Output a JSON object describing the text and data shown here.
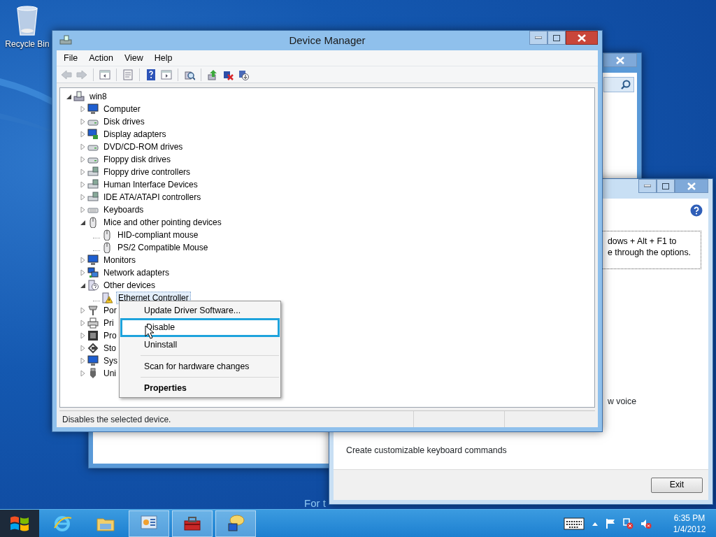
{
  "desktop": {
    "icons": [
      {
        "label": "Recycle Bin"
      }
    ],
    "background_text": "For t"
  },
  "ease_of_access": {
    "hint_lines": [
      "dows + Alt + F1 to",
      "e through the options."
    ],
    "fragment": "w voice",
    "section": {
      "description": "Create customizable keyboard commands"
    },
    "exit_button": "Exit"
  },
  "device_manager": {
    "title": "Device Manager",
    "menu": [
      "File",
      "Action",
      "View",
      "Help"
    ],
    "toolbar": [
      [
        {
          "kind": "back",
          "disabled": true
        },
        {
          "kind": "forward",
          "disabled": true
        }
      ],
      [
        {
          "kind": "tree-pane",
          "disabled": false
        }
      ],
      [
        {
          "kind": "properties",
          "disabled": false
        }
      ],
      [
        {
          "kind": "help",
          "disabled": false
        },
        {
          "kind": "action-pane",
          "disabled": false
        }
      ],
      [
        {
          "kind": "scan",
          "disabled": false
        }
      ],
      [
        {
          "kind": "update",
          "disabled": false
        },
        {
          "kind": "disable",
          "disabled": false
        },
        {
          "kind": "uninstall",
          "disabled": false
        }
      ]
    ],
    "tree": {
      "label": "win8",
      "kind": "host",
      "expanded": true,
      "selected": false,
      "children": [
        {
          "label": "Computer",
          "kind": "computer",
          "expanded": false,
          "selected": false
        },
        {
          "label": "Disk drives",
          "kind": "disk",
          "expanded": false,
          "selected": false
        },
        {
          "label": "Display adapters",
          "kind": "display",
          "expanded": false,
          "selected": false
        },
        {
          "label": "DVD/CD-ROM drives",
          "kind": "disk",
          "expanded": false,
          "selected": false
        },
        {
          "label": "Floppy disk drives",
          "kind": "disk",
          "expanded": false,
          "selected": false
        },
        {
          "label": "Floppy drive controllers",
          "kind": "controller",
          "expanded": false,
          "selected": false
        },
        {
          "label": "Human Interface Devices",
          "kind": "controller",
          "expanded": false,
          "selected": false
        },
        {
          "label": "IDE ATA/ATAPI controllers",
          "kind": "controller",
          "expanded": false,
          "selected": false
        },
        {
          "label": "Keyboards",
          "kind": "keyboard",
          "expanded": false,
          "selected": false
        },
        {
          "label": "Mice and other pointing devices",
          "kind": "mouse",
          "expanded": true,
          "selected": false,
          "children": [
            {
              "label": "HID-compliant mouse",
              "kind": "mouse",
              "selected": false
            },
            {
              "label": "PS/2 Compatible Mouse",
              "kind": "mouse",
              "selected": false
            }
          ]
        },
        {
          "label": "Monitors",
          "kind": "computer",
          "expanded": false,
          "selected": false
        },
        {
          "label": "Network adapters",
          "kind": "network",
          "expanded": false,
          "selected": false
        },
        {
          "label": "Other devices",
          "kind": "unknown",
          "expanded": true,
          "selected": false,
          "children": [
            {
              "label": "Ethernet Controller",
              "kind": "warning",
              "selected": true
            }
          ]
        },
        {
          "label": "Por",
          "kind": "port",
          "expanded": false,
          "selected": false
        },
        {
          "label": "Pri",
          "kind": "printer",
          "expanded": false,
          "selected": false
        },
        {
          "label": "Pro",
          "kind": "chip",
          "expanded": false,
          "selected": false
        },
        {
          "label": "Sto",
          "kind": "storage",
          "expanded": false,
          "selected": false
        },
        {
          "label": "Sys",
          "kind": "computer",
          "expanded": false,
          "selected": false
        },
        {
          "label": "Uni",
          "kind": "usb",
          "expanded": false,
          "selected": false
        }
      ]
    },
    "context_menu": [
      [
        {
          "label": "Update Driver Software...",
          "selected": false,
          "bold": false
        },
        {
          "label": "Disable",
          "selected": true,
          "bold": false
        },
        {
          "label": "Uninstall",
          "selected": false,
          "bold": false
        }
      ],
      [
        {
          "label": "Scan for hardware changes",
          "selected": false,
          "bold": false
        }
      ],
      [
        {
          "label": "Properties",
          "selected": false,
          "bold": true
        }
      ]
    ],
    "status_bar": "Disables the selected device."
  },
  "taskbar": {
    "apps": [
      {
        "kind": "browser",
        "active": false
      },
      {
        "kind": "folder",
        "active": false
      },
      {
        "kind": "control-panel",
        "active": true
      },
      {
        "kind": "toolbox",
        "active": true
      },
      {
        "kind": "chat",
        "active": true
      }
    ],
    "clock": {
      "time": "6:35 PM",
      "date": "1/4/2012"
    }
  }
}
